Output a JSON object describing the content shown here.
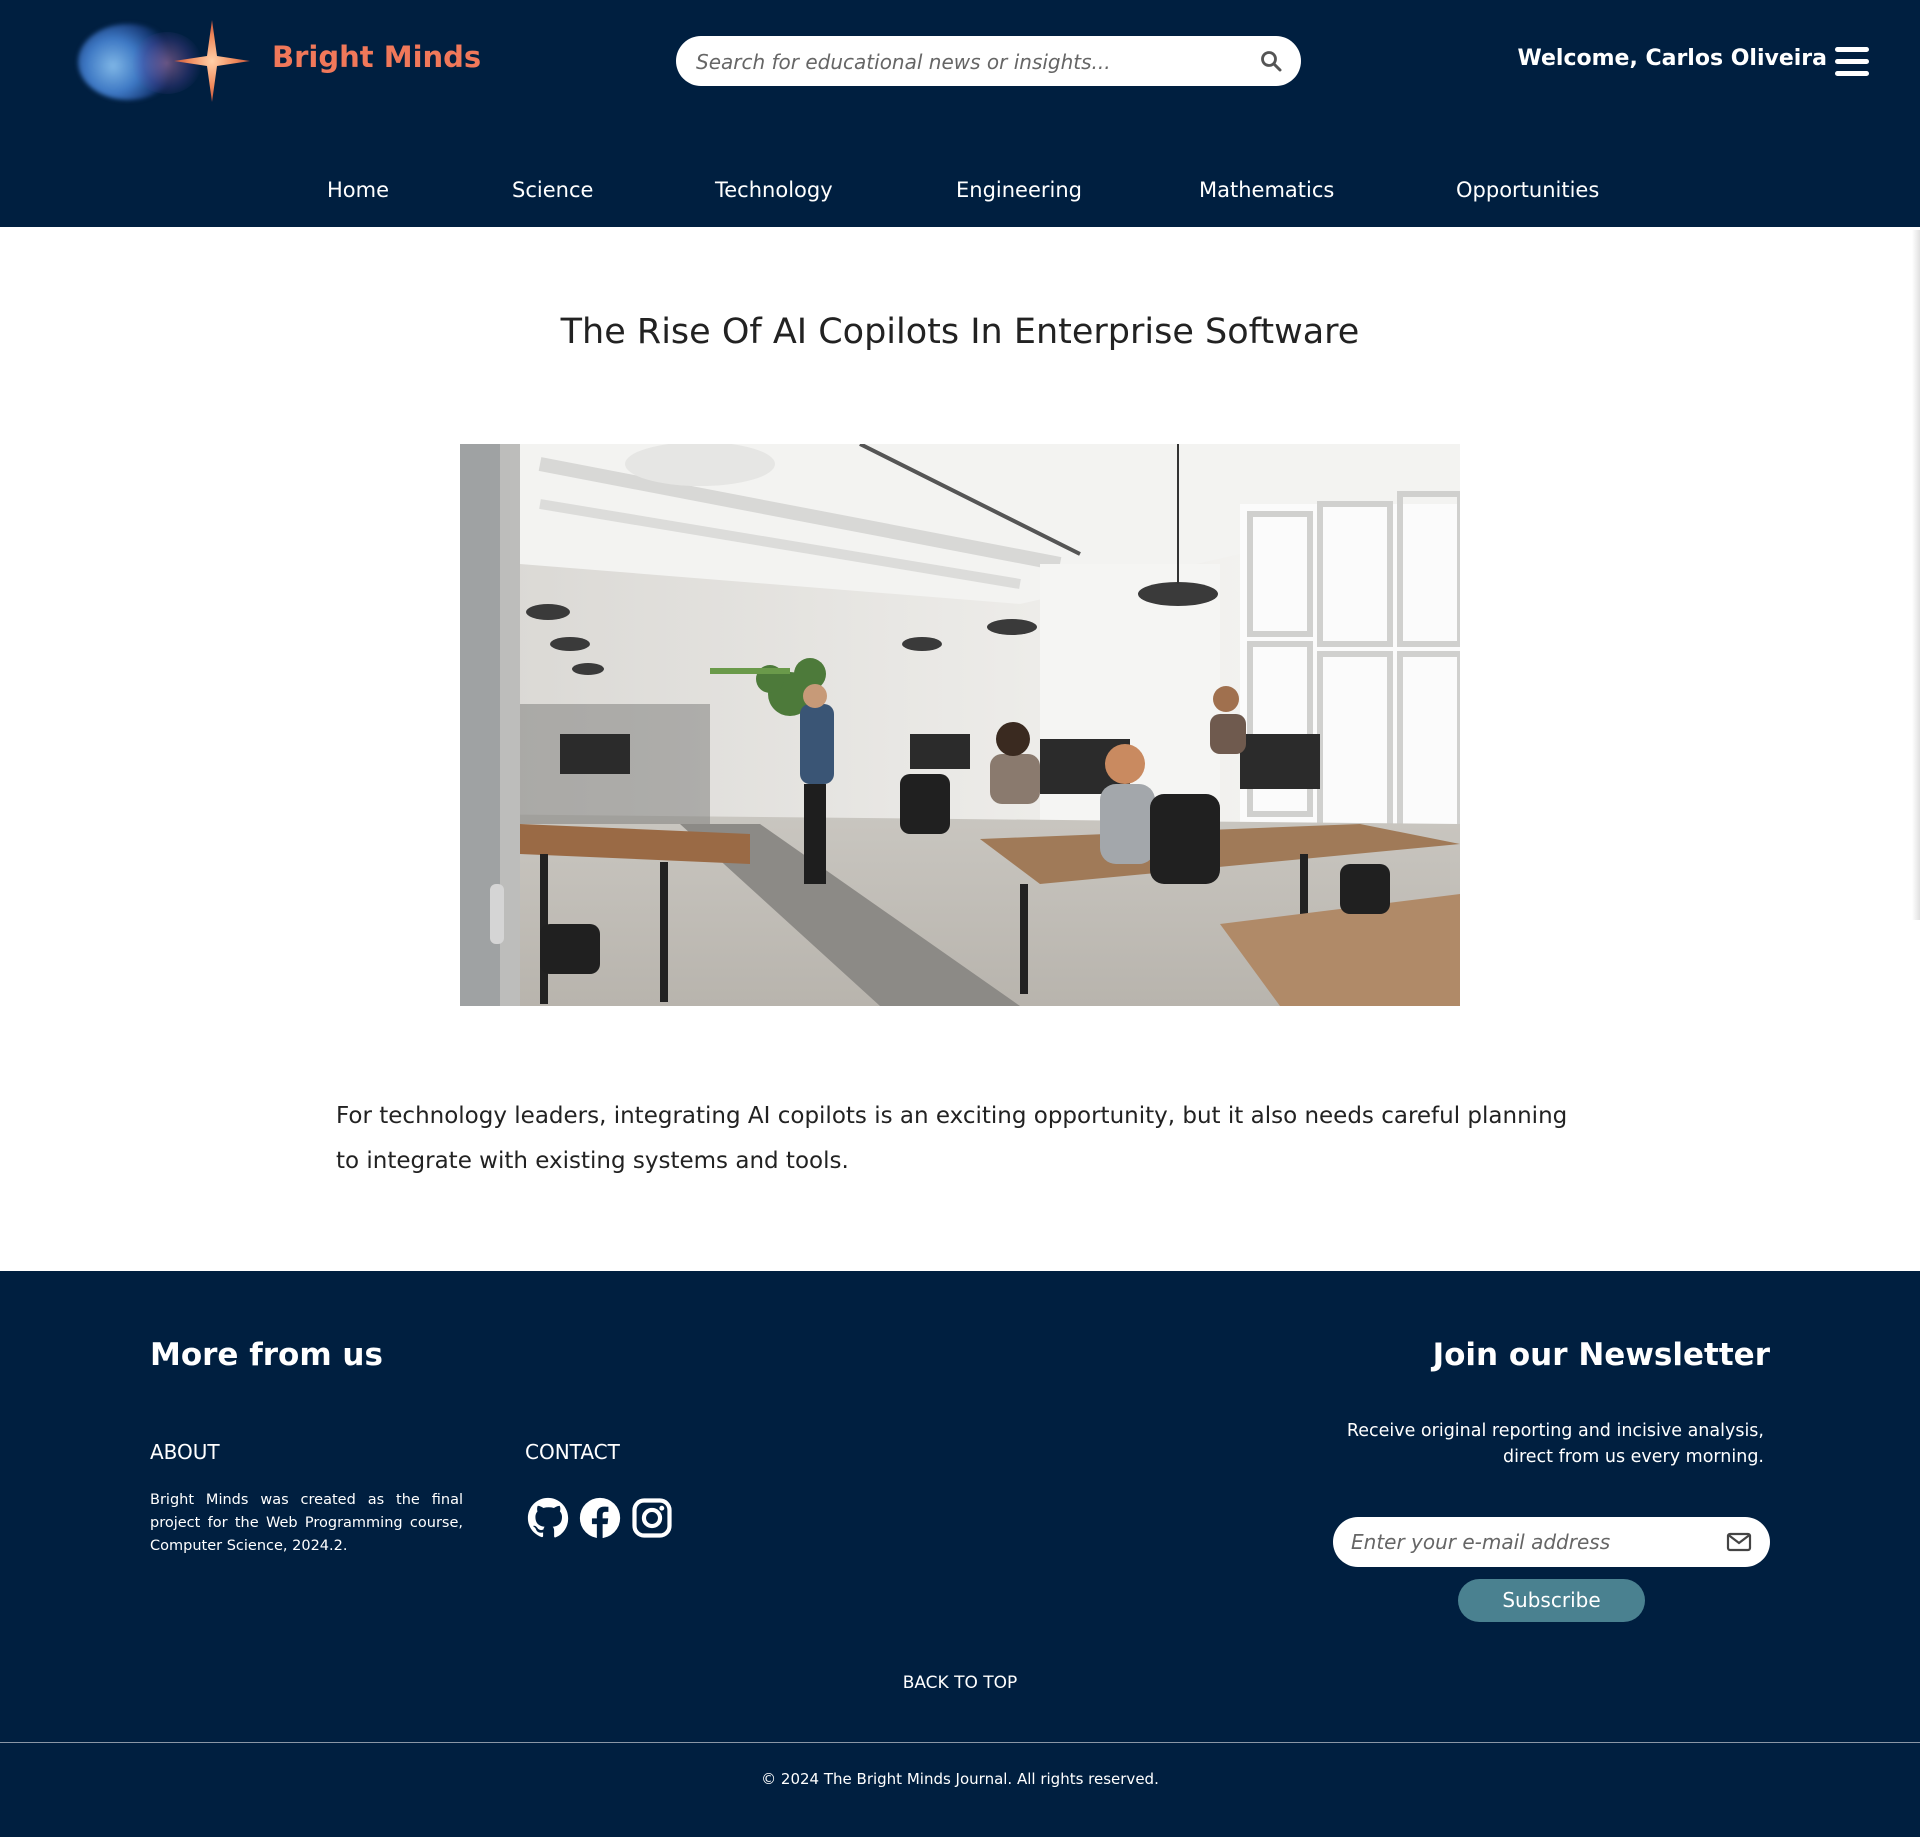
{
  "header": {
    "brand": "Bright Minds",
    "search_placeholder": "Search for educational news or insights...",
    "welcome": "Welcome, Carlos Oliveira"
  },
  "nav": {
    "items": [
      {
        "label": "Home"
      },
      {
        "label": "Science"
      },
      {
        "label": "Technology"
      },
      {
        "label": "Engineering"
      },
      {
        "label": "Mathematics"
      },
      {
        "label": "Opportunities"
      }
    ]
  },
  "article": {
    "title": "The Rise Of AI Copilots In Enterprise Software",
    "body": "For technology leaders, integrating AI copilots is an exciting opportunity, but it also needs careful planning to integrate with existing systems and tools."
  },
  "footer": {
    "more_title": "More from us",
    "about_heading": "ABOUT",
    "about_text": "Bright Minds was created as the final project for the Web Programming course, Computer Science, 2024.2.",
    "contact_heading": "CONTACT",
    "social": [
      "github-icon",
      "facebook-icon",
      "instagram-icon"
    ],
    "newsletter_title": "Join our Newsletter",
    "newsletter_desc": "Receive original reporting and incisive analysis, direct from us every morning.",
    "email_placeholder": "Enter your e-mail address",
    "subscribe_label": "Subscribe",
    "back_to_top": "BACK TO TOP",
    "copyright": "© 2024 The Bright Minds Journal. All rights reserved."
  },
  "colors": {
    "navy": "#001f40",
    "brand_orange": "#f0785a",
    "subscribe_teal": "#4a8190"
  }
}
